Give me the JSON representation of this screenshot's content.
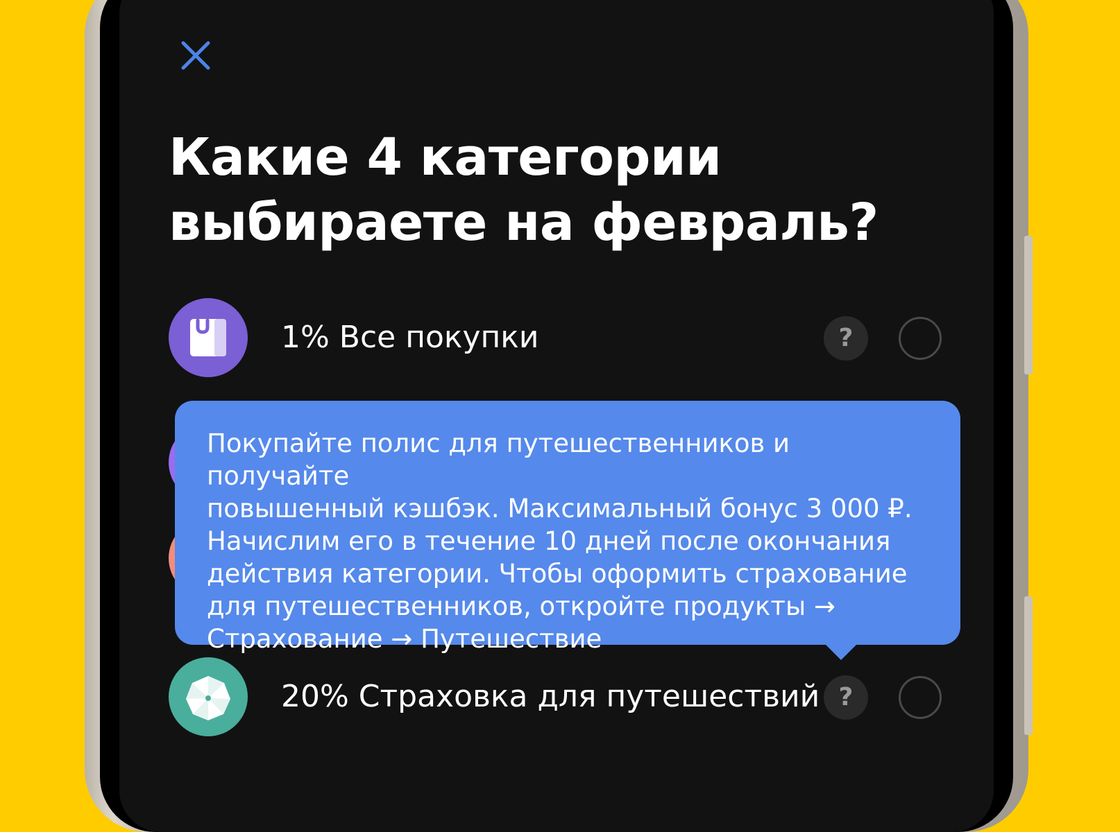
{
  "colors": {
    "background": "#FFCC00",
    "screen": "#121212",
    "accent_blue": "#5589EB",
    "close_icon": "#4C84E8",
    "purchases_icon_bg": "#7B5FD4",
    "travel_icon_bg": "#4AAE9C",
    "hidden_icon_1": "#9A6CF0",
    "hidden_icon_2": "#F28C7E"
  },
  "header": {
    "close_icon": "close-icon"
  },
  "page": {
    "title_line1": "Какие 4 категории",
    "title_line2": "выбираете на февраль?"
  },
  "categories": [
    {
      "label": "1% Все покупки",
      "icon": "shopping-bag-icon",
      "help": "?",
      "selected": false
    },
    {
      "label": "20% Страховка для путешествий",
      "icon": "umbrella-icon",
      "help": "?",
      "selected": false
    }
  ],
  "tooltip": {
    "text": "Покупайте полис для путешественников и получайте\nповышенный кэшбэк. Максимальный бонус 3 000 ₽.\nНачислим его в течение 10 дней после окончания\nдействия категории. Чтобы оформить страхование\nдля путешественников, откройте продукты →\nСтрахование → Путешествие"
  }
}
